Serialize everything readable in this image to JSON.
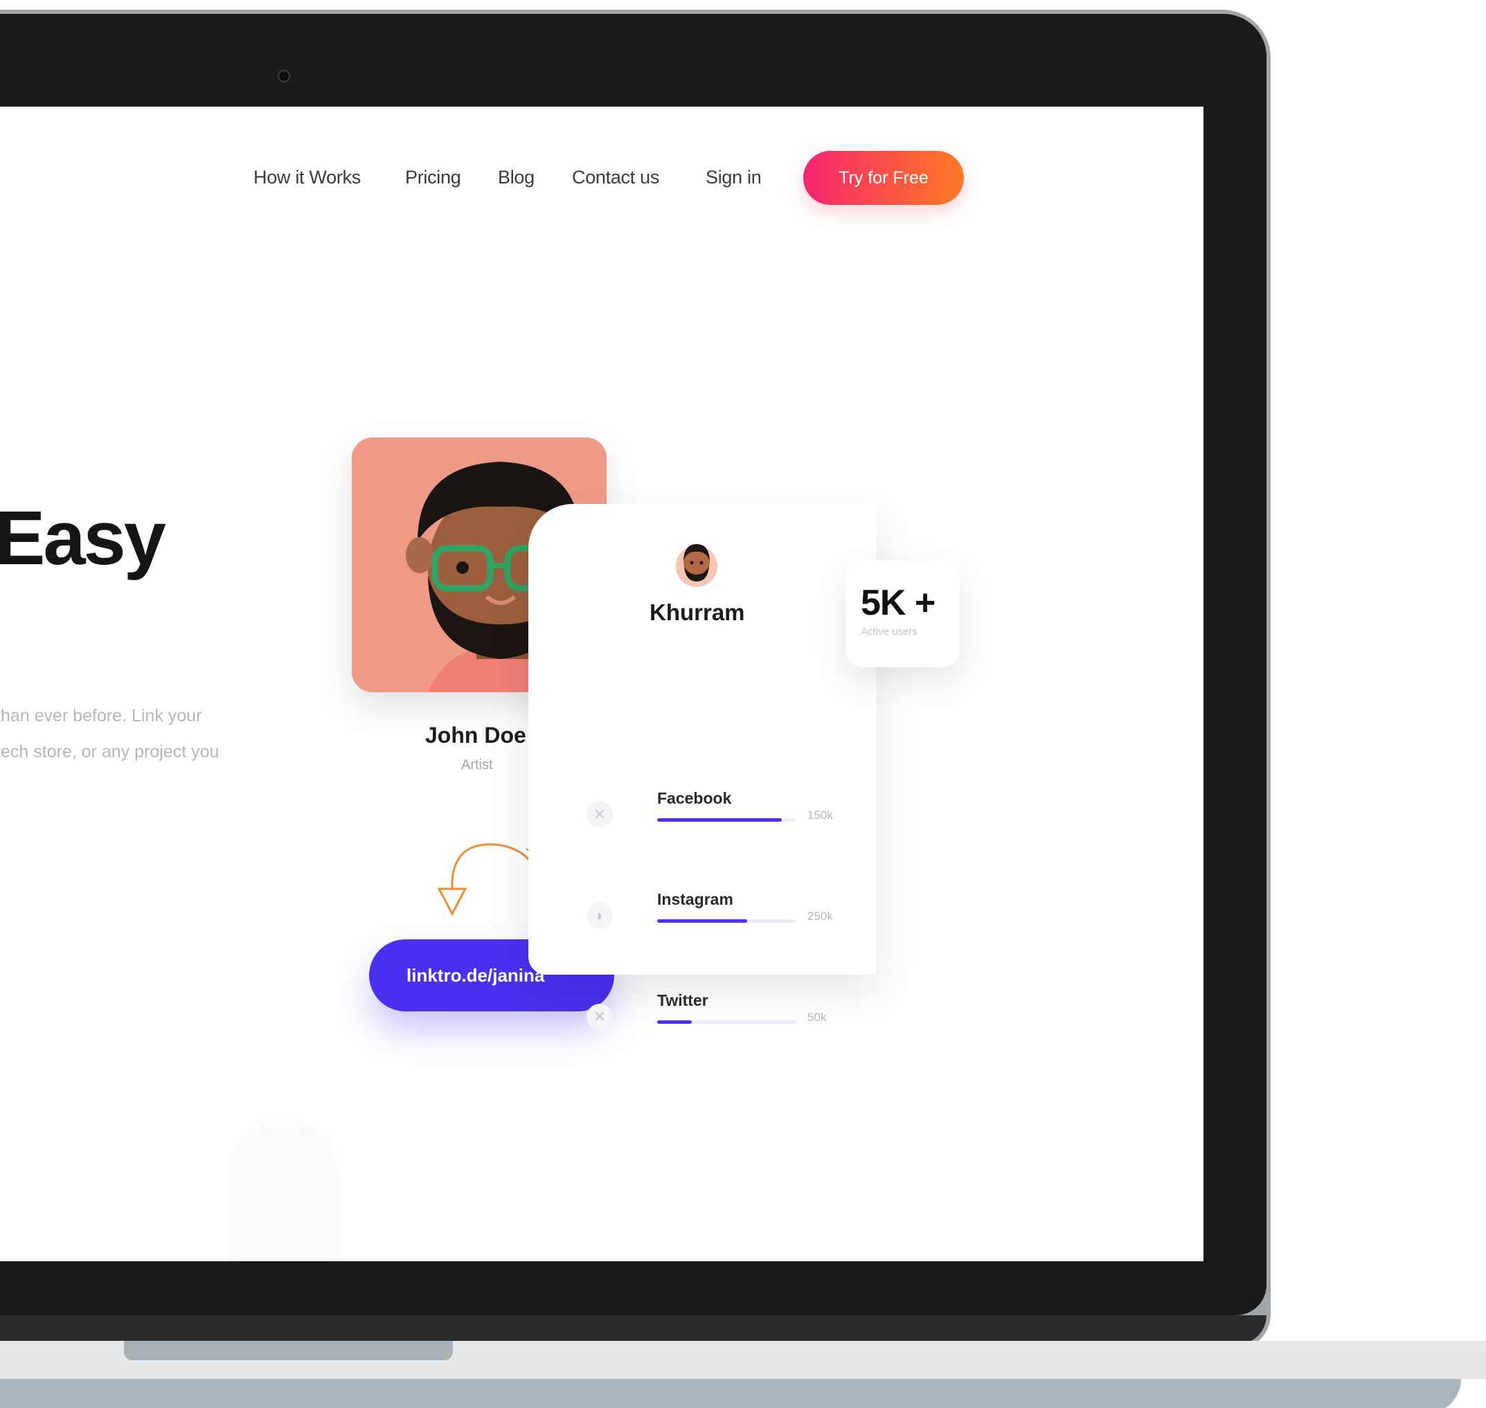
{
  "nav": {
    "items": [
      "How it Works",
      "Pricing",
      "Blog",
      "Contact us",
      "Sign in"
    ],
    "cta_label": "Try for Free"
  },
  "hero": {
    "title": "Easy",
    "text_line1": "than ever before. Link your",
    "text_line2": "tech store, or any project you"
  },
  "profile": {
    "name": "John Doe",
    "role": "Artist",
    "link": "linktro.de/janina"
  },
  "stats_card": {
    "name": "Khurram",
    "items": [
      {
        "label": "Facebook",
        "value": "150k",
        "fill": 0.9,
        "icon": "facebook-icon"
      },
      {
        "label": "Instagram",
        "value": "250k",
        "fill": 0.65,
        "icon": "instagram-icon"
      },
      {
        "label": "Twitter",
        "value": "50k",
        "fill": 0.25,
        "icon": "twitter-icon"
      }
    ]
  },
  "badge": {
    "value": "5K +",
    "label": "Active users"
  },
  "colors": {
    "primary": "#4a30f0",
    "cta_start": "#f5266f",
    "cta_end": "#ff7a24",
    "avatar_bg": "#ee9a87"
  }
}
